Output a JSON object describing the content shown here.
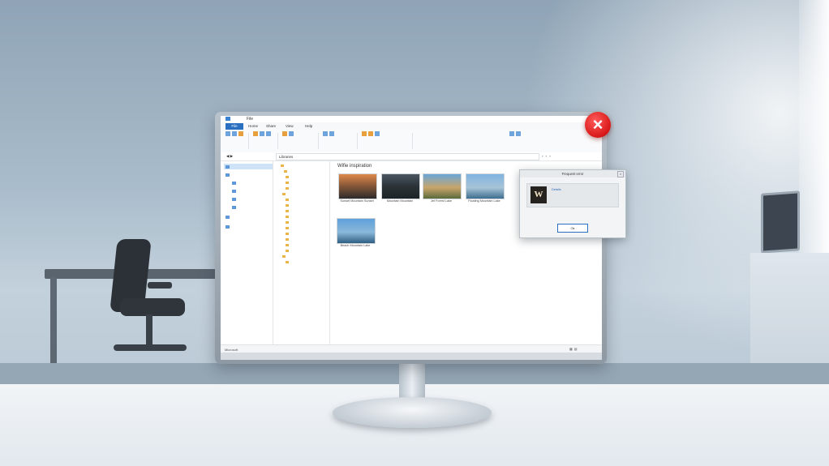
{
  "colors": {
    "accent": "#2b6fc0",
    "error": "#d81818",
    "selection": "#cfe3f8"
  },
  "explorer": {
    "title": "File",
    "tabs": {
      "file": "File",
      "home": "Home",
      "share": "Share",
      "view": "View",
      "help": "Help"
    },
    "address": "Libraries",
    "content_heading": "Wifie inspiration",
    "thumbnails": [
      {
        "icon": "landscape-image-icon",
        "caption": "Sunset Mountain Sunset"
      },
      {
        "icon": "landscape-image-icon",
        "caption": "Mountain Mountain"
      },
      {
        "icon": "landscape-image-icon",
        "caption": "Jet Forest Lake"
      },
      {
        "icon": "landscape-image-icon",
        "caption": "Floating Mountain Lake"
      },
      {
        "icon": "landscape-image-icon",
        "caption": "Beach Mountain Lake"
      }
    ],
    "status": "Microsoft"
  },
  "dialog": {
    "title": "Frequent error",
    "link": "Details",
    "button": "Ok"
  },
  "error_badge": {
    "icon": "error-x-icon"
  }
}
